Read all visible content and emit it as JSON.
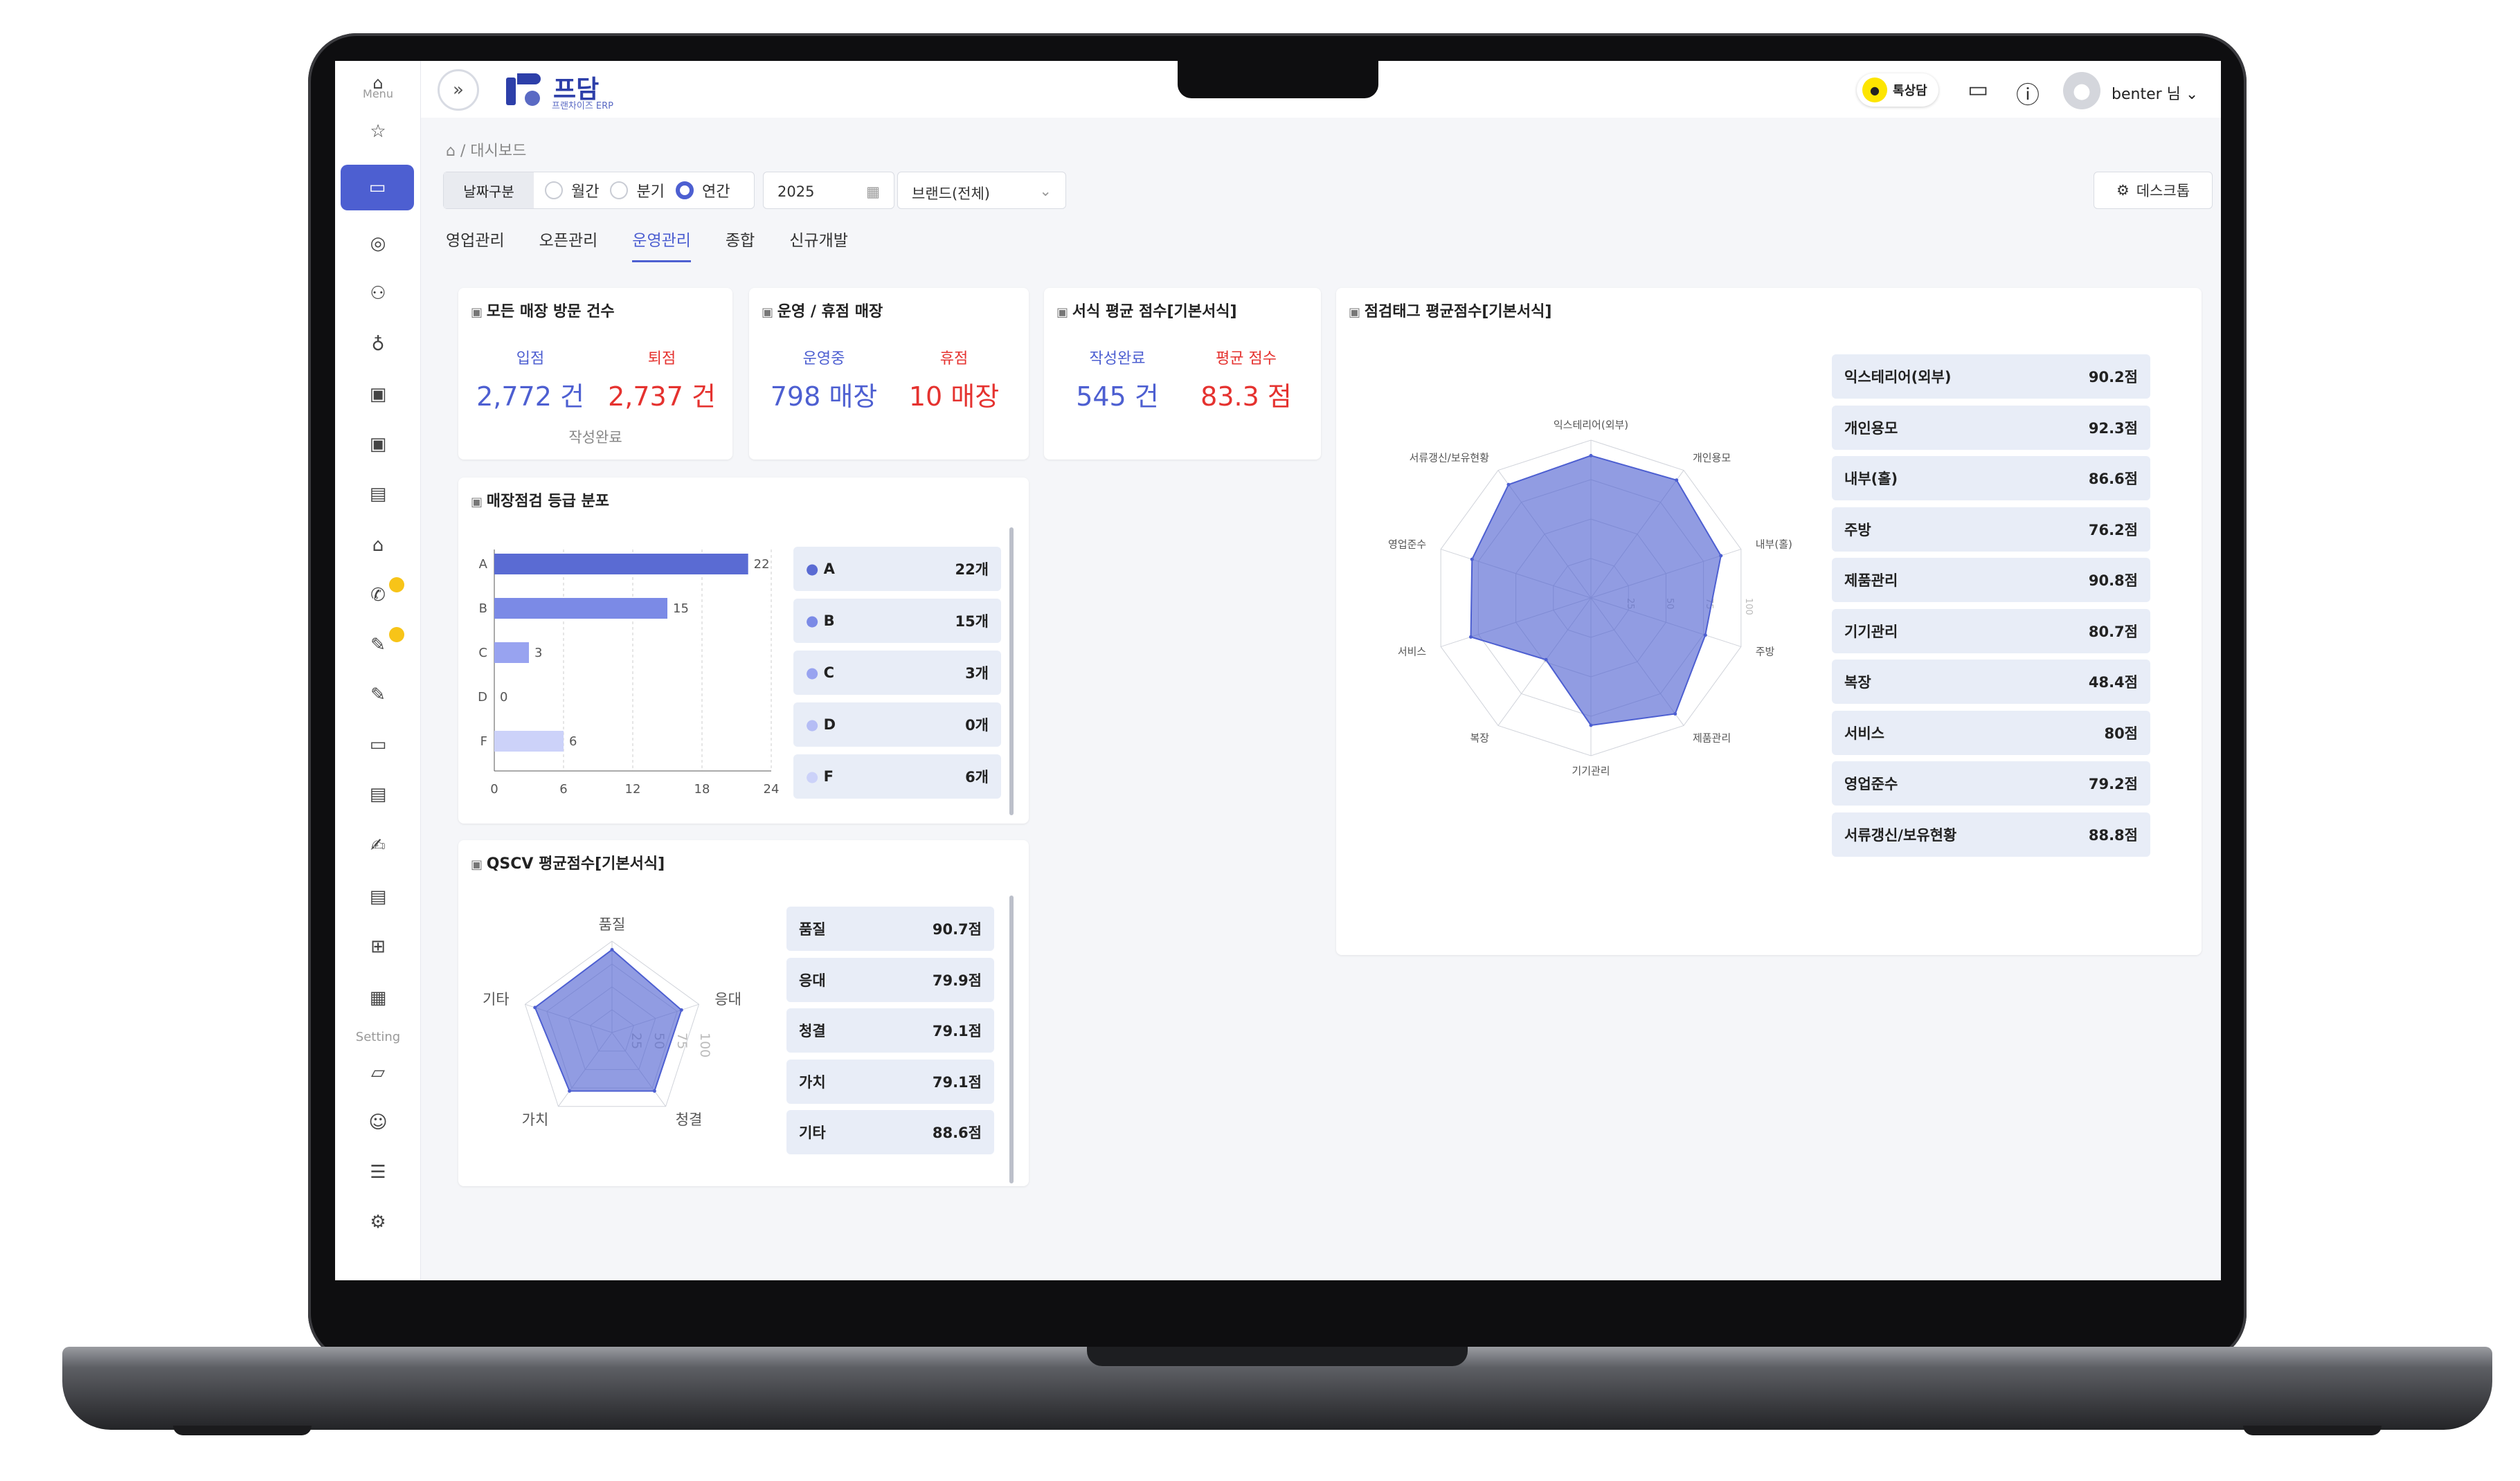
{
  "app": {
    "name": "프담",
    "subtitle": "프랜차이즈 ERP"
  },
  "sidebar": {
    "menu_label": "Menu",
    "setting_label": "Setting"
  },
  "header": {
    "talk_label": "톡상담",
    "user": "benter 님"
  },
  "breadcrumb": {
    "current": "대시보드"
  },
  "filters": {
    "period_label": "날짜구분",
    "options": [
      "월간",
      "분기",
      "연간"
    ],
    "selected": "연간",
    "year": "2025",
    "brand": "브랜드(전체)",
    "desktop": "데스크톱"
  },
  "tabs": [
    "영업관리",
    "오픈관리",
    "운영관리",
    "종합",
    "신규개발"
  ],
  "active_tab": "운영관리",
  "visit": {
    "title": "모든 매장 방문 건수",
    "in_label": "입점",
    "in_value": "2,772 건",
    "out_label": "퇴점",
    "out_value": "2,737 건",
    "footer": "작성완료"
  },
  "ops": {
    "title": "운영 / 휴점 매장",
    "run_label": "운영중",
    "run_value": "798 매장",
    "closed_label": "휴점",
    "closed_value": "10 매장"
  },
  "form": {
    "title": "서식 평균 점수[기본서식]",
    "done_label": "작성완료",
    "done_value": "545 건",
    "avg_label": "평균 점수",
    "avg_value": "83.3 점"
  },
  "grade": {
    "title": "매장점검 등급 분포"
  },
  "qscv": {
    "title": "QSCV 평균점수[기본서식]"
  },
  "tag": {
    "title": "점검태그 평균점수[기본서식]"
  },
  "chart_data": [
    {
      "type": "bar",
      "title": "매장점검 등급 분포",
      "categories": [
        "A",
        "B",
        "C",
        "D",
        "F"
      ],
      "values": [
        22,
        15,
        3,
        0,
        6
      ],
      "xlim": [
        0,
        24
      ],
      "xticks": [
        0,
        6,
        12,
        18,
        24
      ],
      "legend": [
        "22개",
        "15개",
        "3개",
        "0개",
        "6개"
      ],
      "colors": [
        "#5a6bd3",
        "#7b8ae6",
        "#98a3f0",
        "#b5bdf5",
        "#ccd2f9"
      ]
    },
    {
      "type": "radar",
      "title": "QSCV 평균점수[기본서식]",
      "categories": [
        "품질",
        "응대",
        "청결",
        "가치",
        "기타"
      ],
      "values": [
        90.7,
        79.9,
        79.1,
        79.1,
        88.6
      ],
      "max": 100,
      "ticks": [
        25,
        50,
        75,
        100
      ],
      "legend": [
        "90.7점",
        "79.9점",
        "79.1점",
        "79.1점",
        "88.6점"
      ]
    },
    {
      "type": "radar",
      "title": "점검태그 평균점수[기본서식]",
      "categories": [
        "익스테리어(외부)",
        "개인용모",
        "내부(홀)",
        "주방",
        "제품관리",
        "기기관리",
        "복장",
        "서비스",
        "영업준수",
        "서류갱신/보유현황"
      ],
      "values": [
        90.2,
        92.3,
        86.6,
        76.2,
        90.8,
        80.7,
        48.4,
        80,
        79.2,
        88.8
      ],
      "max": 100,
      "ticks": [
        25,
        50,
        75,
        100
      ],
      "legend": [
        "90.2점",
        "92.3점",
        "86.6점",
        "76.2점",
        "90.8점",
        "80.7점",
        "48.4점",
        "80점",
        "79.2점",
        "88.8점"
      ]
    }
  ],
  "colors": {
    "accent": "#4d5fd1",
    "red": "#e5322f"
  }
}
